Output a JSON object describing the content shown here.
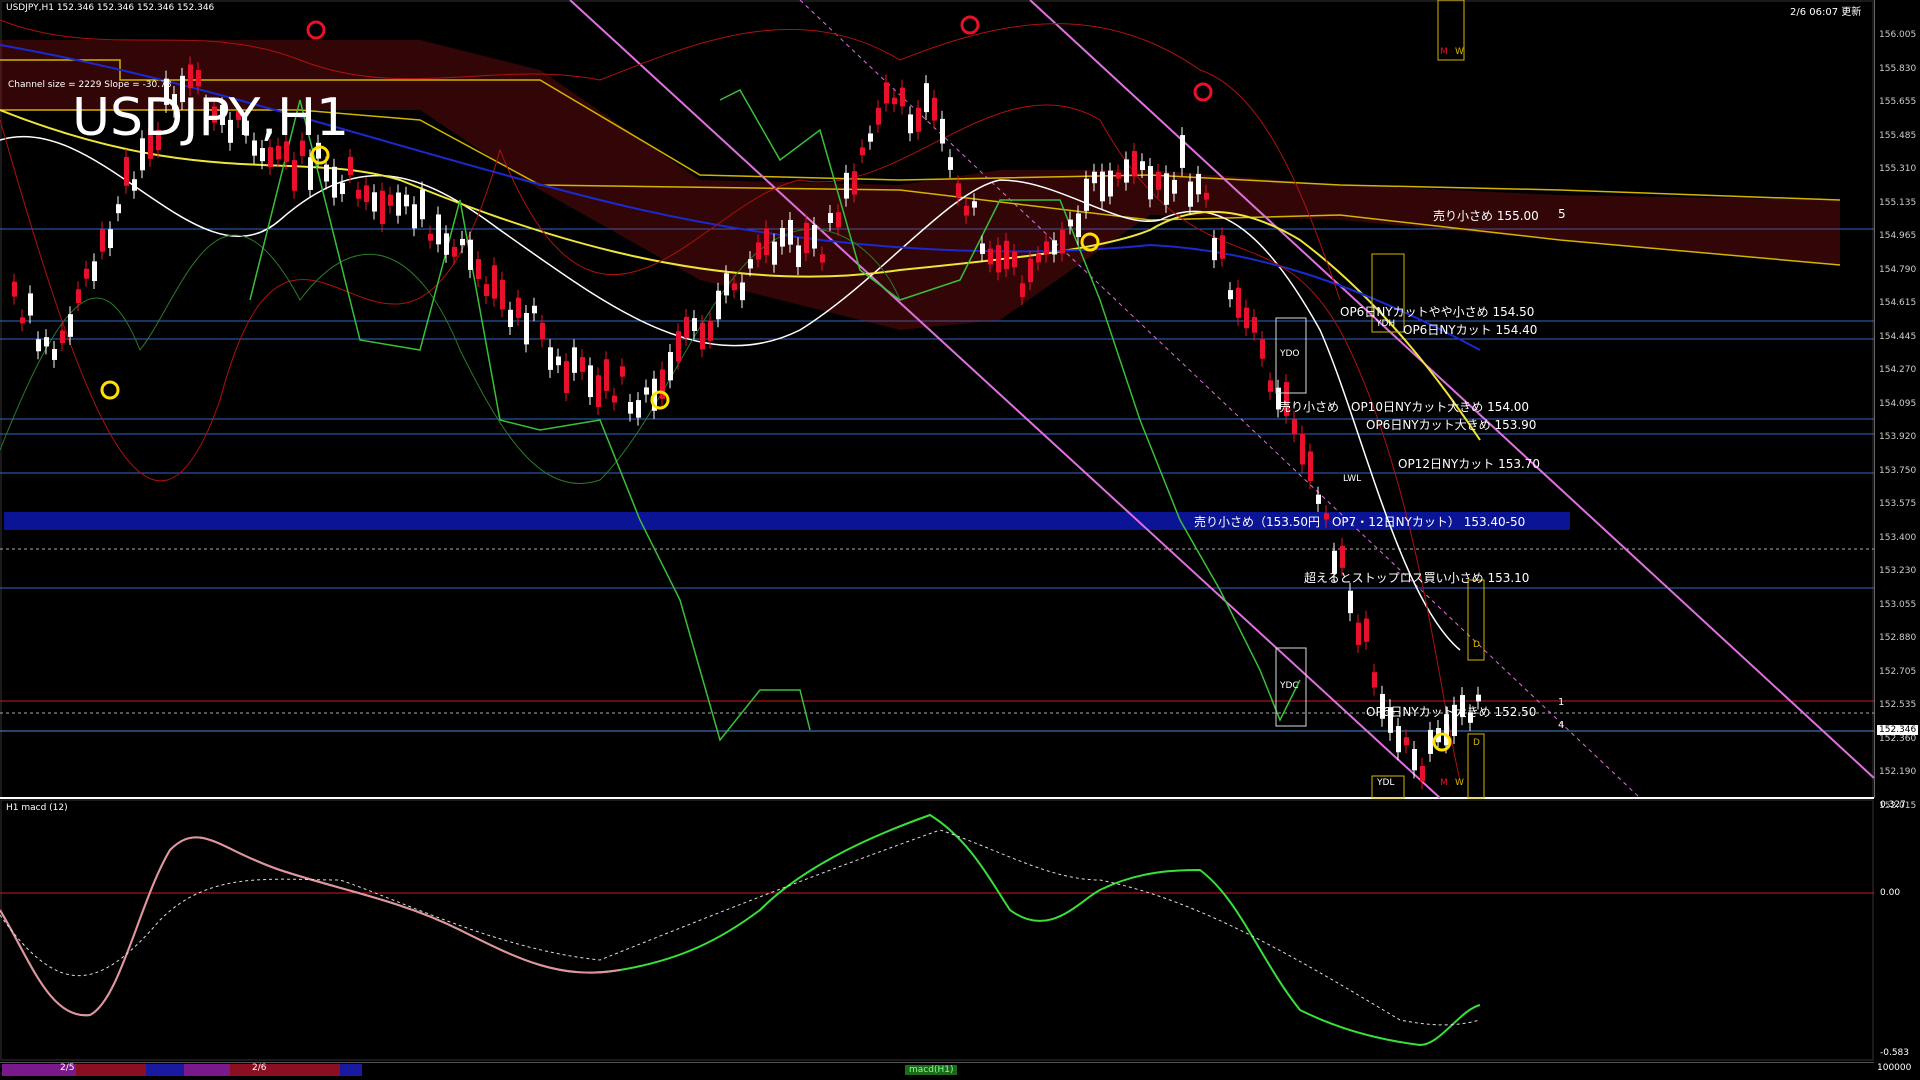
{
  "header": {
    "symbol_info": "USDJPY,H1 152.346 152.346 152.346 152.346",
    "time": "2/6 06:07 更新",
    "channel_info": "Channel size = 2229 Slope = -30.78",
    "watermark": "USDJPY,H1"
  },
  "price_axis": [
    "156.005",
    "155.830",
    "155.655",
    "155.485",
    "155.310",
    "155.135",
    "154.965",
    "154.790",
    "154.615",
    "154.445",
    "154.270",
    "154.095",
    "153.920",
    "153.750",
    "153.575",
    "153.400",
    "153.230",
    "153.055",
    "152.880",
    "152.705",
    "152.535",
    "152.360",
    "152.190",
    "152.015"
  ],
  "current_price": "152.346",
  "levels": [
    {
      "label": "売り小さめ 155.00",
      "num": "5"
    },
    {
      "label": "OP6日NYカットやや小さめ 154.50"
    },
    {
      "label": "OP6日NYカット 154.40"
    },
    {
      "label": "売り小さめ　OP10日NYカット大きめ 154.00"
    },
    {
      "label": "OP6日NYカット大きめ 153.90"
    },
    {
      "label": "OP12日NYカット 153.70"
    },
    {
      "label": "売り小さめ（153.50円　OP7・12日NYカット） 153.40-50"
    },
    {
      "label": "超えるとストップロス買い小さめ 153.10"
    },
    {
      "label": "OP6日NYカット大きめ 152.50",
      "num1": "1",
      "num2": "4"
    }
  ],
  "boxes": {
    "ydo": "YDO",
    "ydc": "YDC",
    "ydl": "YDL",
    "ydh": "YDH",
    "lwl": "LWL",
    "m": "M",
    "w": "W",
    "d": "D"
  },
  "macd": {
    "title": "H1  macd (12)",
    "axis_top": "0.327",
    "axis_zero": "0.00",
    "axis_bottom": "-0.583",
    "axis_scale": "100000"
  },
  "timeline": {
    "d1": "2/5",
    "d2": "2/6",
    "tag": "macd(H1)"
  },
  "colors": {
    "up": "#ffffff",
    "down": "#e8102a",
    "ichimoku": "#d4b400",
    "channel": "#e070e0",
    "hline": "#2e68c8",
    "band": "#0a1494",
    "macd": "#39e039",
    "macd_neg": "#e98fa4"
  }
}
